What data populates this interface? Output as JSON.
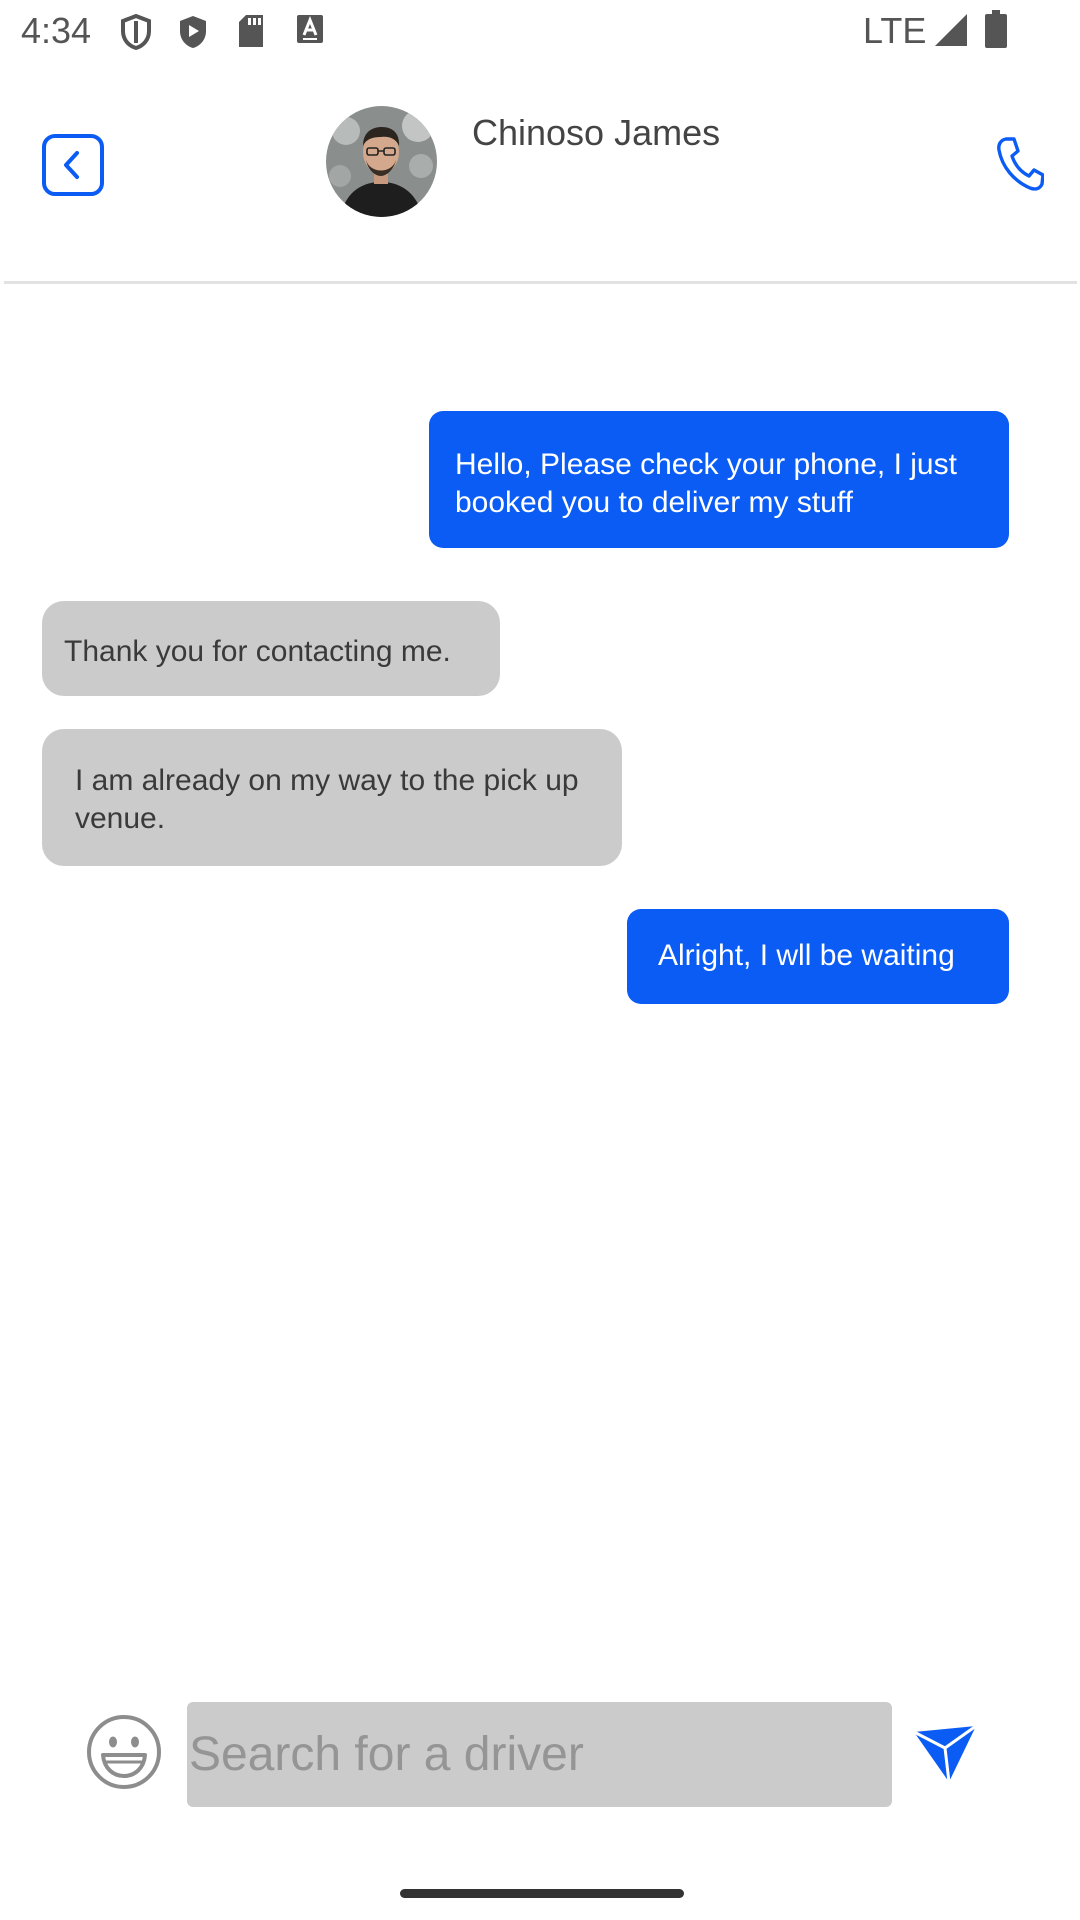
{
  "status_bar": {
    "time": "4:34",
    "network": "LTE",
    "icons": [
      "shield-outline-icon",
      "shield-play-icon",
      "sd-card-icon",
      "keyboard-a-icon",
      "signal-icon",
      "battery-icon"
    ]
  },
  "header": {
    "contact_name": "Chinoso James",
    "back_icon": "chevron-left-icon",
    "call_icon": "phone-icon",
    "accent_color": "#0a5cf5"
  },
  "messages": [
    {
      "direction": "outgoing",
      "text": "Hello, Please check your phone, I just booked you to deliver my stuff"
    },
    {
      "direction": "incoming",
      "text": "Thank you for contacting me."
    },
    {
      "direction": "incoming",
      "text": "I am already on my way to the pick up venue."
    },
    {
      "direction": "outgoing",
      "text": "Alright, I wll be waiting"
    }
  ],
  "composer": {
    "placeholder": "Search for a driver",
    "value": "",
    "emoji_icon": "smiley-icon",
    "send_icon": "send-icon"
  },
  "colors": {
    "outgoing_bubble": "#0a5cf5",
    "incoming_bubble": "#cbcbcb",
    "input_background": "#cbcbcb"
  }
}
